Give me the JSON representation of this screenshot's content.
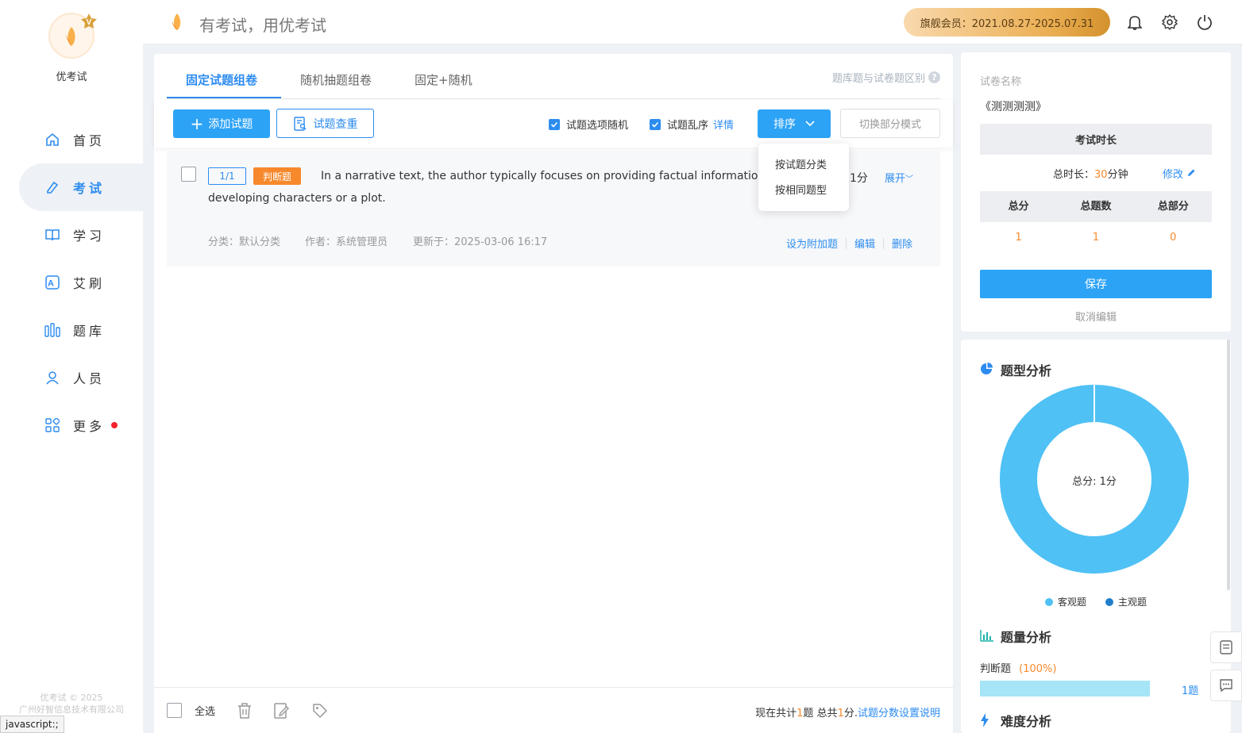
{
  "sidebar": {
    "brand": "优考试",
    "items": [
      {
        "label": "首页",
        "icon": "home-icon",
        "active": false
      },
      {
        "label": "考试",
        "icon": "exam-icon",
        "active": true
      },
      {
        "label": "学习",
        "icon": "book-icon",
        "active": false
      },
      {
        "label": "艾刷",
        "icon": "letter-a-icon",
        "active": false
      },
      {
        "label": "题库",
        "icon": "question-bank-icon",
        "active": false
      },
      {
        "label": "人员",
        "icon": "user-icon",
        "active": false
      },
      {
        "label": "更多",
        "icon": "grid-icon",
        "active": false,
        "badge_dot": true
      }
    ],
    "copyright_line1": "优考试 © 2025",
    "copyright_line2": "广州好智信息技术有限公司"
  },
  "status_bar": "javascript:;",
  "header": {
    "slogan": "有考试，用优考试",
    "member_text": "旗舰会员：2021.08.27-2025.07.31"
  },
  "tabs": {
    "items": [
      "固定试题组卷",
      "随机抽题组卷",
      "固定+随机"
    ],
    "active_index": 0,
    "difference_link": "题库题与试卷题区别",
    "help_mark": "?"
  },
  "toolbar": {
    "add_label": "添加试题",
    "duplicate_label": "试题查重",
    "option_random_label": "试题选项随机",
    "shuffle_label": "试题乱序",
    "detail_link": "详情",
    "sort_label": "排序",
    "switch_label": "切换部分模式"
  },
  "sort_menu": [
    "按试题分类",
    "按相同题型"
  ],
  "question": {
    "index": "1/1",
    "type": "判断题",
    "text": "In a narrative text, the author typically focuses on providing factual information rather than developing characters or a plot.",
    "score": "1分",
    "expand": "展开",
    "category": "分类：默认分类",
    "author": "作者：系统管理员",
    "updated": "更新于：2025-03-06 16:17",
    "actions": [
      "设为附加题",
      "编辑",
      "删除"
    ]
  },
  "footer": {
    "select_all": "全选",
    "summary_prefix": "现在共计",
    "question_count": "1",
    "summary_mid": "题 总共",
    "total_score": "1",
    "summary_suffix": "分.",
    "explain_link": "试题分数设置说明"
  },
  "paper": {
    "name_label": "试卷名称",
    "name": "《测测测测》",
    "duration_title": "考试时长",
    "duration_prefix": "总时长：",
    "duration_value": "30",
    "duration_unit": "分钟",
    "modify_link": "修改",
    "score_headers": [
      "总分",
      "总题数",
      "总部分"
    ],
    "score_values": [
      "1",
      "1",
      "0"
    ],
    "save_label": "保存",
    "cancel_label": "取消编辑"
  },
  "analysis": {
    "type_title": "题型分析",
    "center_label": "总分: 1分",
    "legend": [
      {
        "name": "客观题",
        "color": "#4fc1f5"
      },
      {
        "name": "主观题",
        "color": "#1f7fcc"
      }
    ],
    "qty_title": "题量分析",
    "qty_label": "判断题",
    "qty_percent": "(100%)",
    "qty_fraction": 1.0,
    "qty_count": "1题",
    "difficulty_title": "难度分析"
  },
  "chart_data": {
    "type": "pie",
    "categories": [
      "客观题",
      "主观题"
    ],
    "values": [
      1,
      0
    ]
  }
}
